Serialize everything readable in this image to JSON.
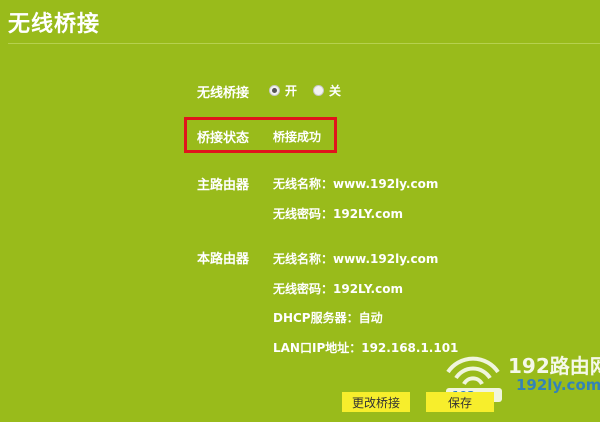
{
  "page": {
    "title": "无线桥接"
  },
  "bridge": {
    "label": "无线桥接",
    "options": [
      {
        "label": "开",
        "checked": true
      },
      {
        "label": "关",
        "checked": false
      }
    ]
  },
  "status": {
    "label": "桥接状态",
    "value": "桥接成功"
  },
  "main_router": {
    "label": "主路由器",
    "ssid": "无线名称：www.192ly.com",
    "password": "无线密码：192LY.com"
  },
  "this_router": {
    "label": "本路由器",
    "ssid": "无线名称：www.192ly.com",
    "password": "无线密码：192LY.com",
    "dhcp": "DHCP服务器：自动",
    "lan_ip": "LAN口IP地址：192.168.1.101"
  },
  "buttons": {
    "change": "更改桥接",
    "save": "保存"
  },
  "watermark": {
    "brand": "192路由网",
    "url": "192ly.com"
  },
  "colors": {
    "background": "#99bb1b",
    "highlight_border": "#e0141c",
    "button": "#f7ee2c"
  }
}
